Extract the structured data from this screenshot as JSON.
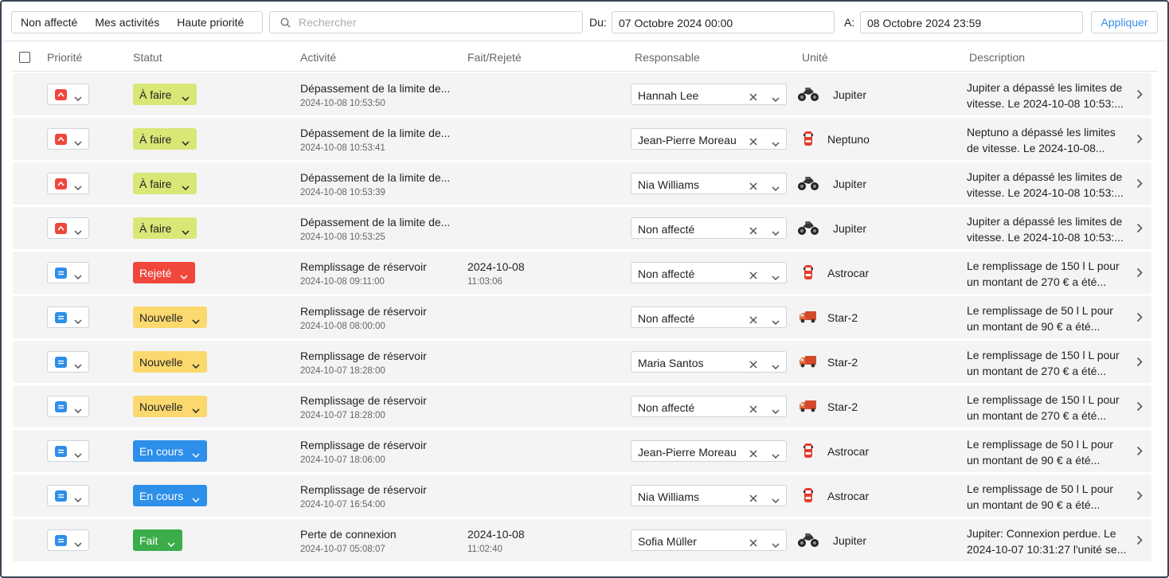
{
  "toolbar": {
    "filters": [
      "Non affecté",
      "Mes activités",
      "Haute priorité"
    ],
    "search_placeholder": "Rechercher",
    "from_label": "Du:",
    "from_value": "07 Octobre 2024 00:00",
    "to_label": "A:",
    "to_value": "08 Octobre 2024 23:59",
    "apply_label": "Appliquer"
  },
  "columns": [
    "Priorité",
    "Statut",
    "Activité",
    "Fait/Rejeté",
    "Responsable",
    "Unité",
    "Description"
  ],
  "colors": {
    "priority_high": "#f0463c",
    "priority_normal": "#2d8fe9",
    "status_todo": "#d9e776",
    "status_rejected": "#f0463c",
    "status_new": "#fbd96f",
    "status_in_progress": "#2d8fe9",
    "status_done": "#3aad4a",
    "accent": "#3b8ee6"
  },
  "rows": [
    {
      "priority": "high",
      "status": "À faire",
      "status_kind": "todo",
      "activity": "Dépassement de la limite de...",
      "activity_date": "2024-10-08 10:53:50",
      "done_date": "",
      "done_time": "",
      "responsible": "Hannah Lee",
      "unit_icon": "motorcycle-icon",
      "unit": "Jupiter",
      "desc1": "Jupiter a dépassé les limites de",
      "desc2": "vitesse. Le 2024-10-08 10:53:..."
    },
    {
      "priority": "high",
      "status": "À faire",
      "status_kind": "todo",
      "activity": "Dépassement de la limite de...",
      "activity_date": "2024-10-08 10:53:41",
      "done_date": "",
      "done_time": "",
      "responsible": "Jean-Pierre Moreau",
      "unit_icon": "car-icon",
      "unit": "Neptuno",
      "desc1": "Neptuno a dépassé les limites",
      "desc2": "de vitesse. Le 2024-10-08..."
    },
    {
      "priority": "high",
      "status": "À faire",
      "status_kind": "todo",
      "activity": "Dépassement de la limite de...",
      "activity_date": "2024-10-08 10:53:39",
      "done_date": "",
      "done_time": "",
      "responsible": "Nia Williams",
      "unit_icon": "motorcycle-icon",
      "unit": "Jupiter",
      "desc1": "Jupiter a dépassé les limites de",
      "desc2": "vitesse. Le 2024-10-08 10:53:..."
    },
    {
      "priority": "high",
      "status": "À faire",
      "status_kind": "todo",
      "activity": "Dépassement de la limite de...",
      "activity_date": "2024-10-08 10:53:25",
      "done_date": "",
      "done_time": "",
      "responsible": "Non affecté",
      "unit_icon": "motorcycle-icon",
      "unit": "Jupiter",
      "desc1": "Jupiter a dépassé les limites de",
      "desc2": "vitesse. Le 2024-10-08 10:53:..."
    },
    {
      "priority": "normal",
      "status": "Rejeté",
      "status_kind": "rejected",
      "activity": "Remplissage de réservoir",
      "activity_date": "2024-10-08 09:11:00",
      "done_date": "2024-10-08",
      "done_time": "11:03:06",
      "responsible": "Non affecté",
      "unit_icon": "car-icon",
      "unit": "Astrocar",
      "desc1": "Le remplissage de 150 l L pour",
      "desc2": "un montant de 270 € a été..."
    },
    {
      "priority": "normal",
      "status": "Nouvelle",
      "status_kind": "new",
      "activity": "Remplissage de réservoir",
      "activity_date": "2024-10-08 08:00:00",
      "done_date": "",
      "done_time": "",
      "responsible": "Non affecté",
      "unit_icon": "truck-icon",
      "unit": "Star-2",
      "desc1": "Le remplissage de 50 l L pour",
      "desc2": "un montant de 90 € a été..."
    },
    {
      "priority": "normal",
      "status": "Nouvelle",
      "status_kind": "new",
      "activity": "Remplissage de réservoir",
      "activity_date": "2024-10-07 18:28:00",
      "done_date": "",
      "done_time": "",
      "responsible": "Maria Santos",
      "unit_icon": "truck-icon",
      "unit": "Star-2",
      "desc1": "Le remplissage de 150 l L pour",
      "desc2": "un montant de 270 € a été..."
    },
    {
      "priority": "normal",
      "status": "Nouvelle",
      "status_kind": "new",
      "activity": "Remplissage de réservoir",
      "activity_date": "2024-10-07 18:28:00",
      "done_date": "",
      "done_time": "",
      "responsible": "Non affecté",
      "unit_icon": "truck-icon",
      "unit": "Star-2",
      "desc1": "Le remplissage de 150 l L pour",
      "desc2": "un montant de 270 € a été..."
    },
    {
      "priority": "normal",
      "status": "En cours",
      "status_kind": "in_progress",
      "activity": "Remplissage de réservoir",
      "activity_date": "2024-10-07 18:06:00",
      "done_date": "",
      "done_time": "",
      "responsible": "Jean-Pierre Moreau",
      "unit_icon": "car-icon",
      "unit": "Astrocar",
      "desc1": "Le remplissage de 50 l L pour",
      "desc2": "un montant de 90 € a été..."
    },
    {
      "priority": "normal",
      "status": "En cours",
      "status_kind": "in_progress",
      "activity": "Remplissage de réservoir",
      "activity_date": "2024-10-07 16:54:00",
      "done_date": "",
      "done_time": "",
      "responsible": "Nia Williams",
      "unit_icon": "car-icon",
      "unit": "Astrocar",
      "desc1": "Le remplissage de 50 l L pour",
      "desc2": "un montant de 90 € a été..."
    },
    {
      "priority": "normal",
      "status": "Fait",
      "status_kind": "done",
      "activity": "Perte de connexion",
      "activity_date": "2024-10-07 05:08:07",
      "done_date": "2024-10-08",
      "done_time": "11:02:40",
      "responsible": "Sofia Müller",
      "unit_icon": "motorcycle-icon",
      "unit": "Jupiter",
      "desc1": "Jupiter: Connexion perdue. Le",
      "desc2": "2024-10-07 10:31:27 l'unité se..."
    }
  ]
}
